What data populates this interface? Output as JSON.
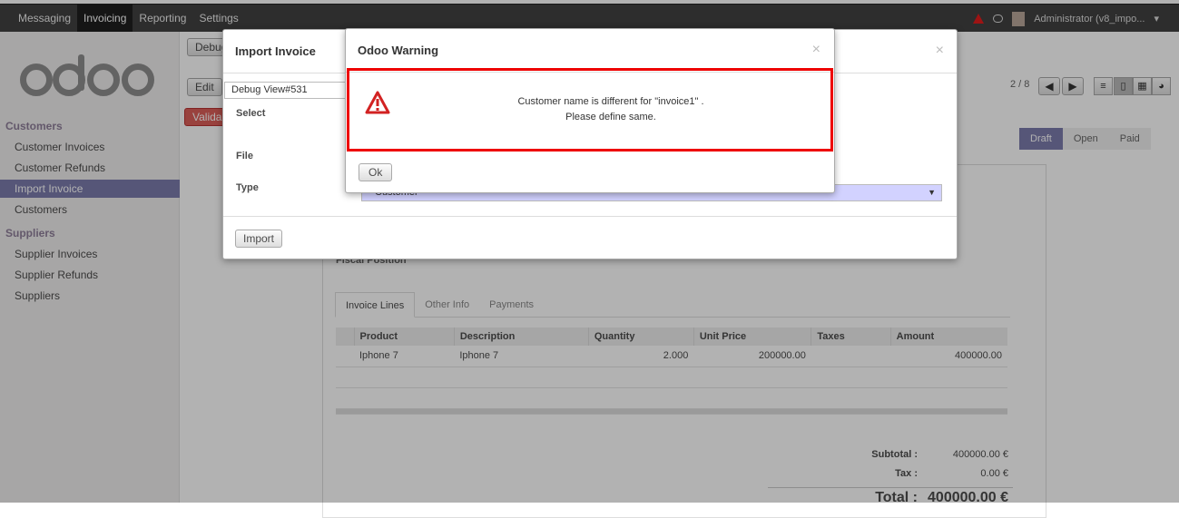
{
  "topbar": {
    "menu": [
      "Messaging",
      "Invoicing",
      "Reporting",
      "Settings"
    ],
    "active_menu": "Invoicing",
    "user": "Administrator (v8_impo..."
  },
  "sidebar": {
    "logo": "odoo",
    "sections": [
      {
        "label": "Customers",
        "items": [
          "Customer Invoices",
          "Customer Refunds",
          "Import Invoice",
          "Customers"
        ]
      },
      {
        "label": "Suppliers",
        "items": [
          "Supplier Invoices",
          "Supplier Refunds",
          "Suppliers"
        ]
      }
    ],
    "active_item": "Import Invoice"
  },
  "main": {
    "debug_label": "Debug",
    "edit_label": "Edit",
    "validate_label": "Valida",
    "pager": "2 / 8",
    "statusbar": [
      "Draft",
      "Open",
      "Paid"
    ],
    "active_status": "Draft",
    "fiscal_position_label": "Fiscal Position",
    "tabs": [
      "Invoice Lines",
      "Other Info",
      "Payments"
    ],
    "active_tab": "Invoice Lines",
    "lines_headers": [
      "Product",
      "Description",
      "Quantity",
      "Unit Price",
      "Taxes",
      "Amount"
    ],
    "lines": [
      {
        "product": "Iphone 7",
        "description": "Iphone 7",
        "quantity": "2.000",
        "unit_price": "200000.00",
        "taxes": "",
        "amount": "400000.00"
      }
    ],
    "subtotal_label": "Subtotal :",
    "subtotal": "400000.00 €",
    "tax_label": "Tax :",
    "tax": "0.00 €",
    "total_label": "Total :",
    "total": "400000.00 €"
  },
  "import_dialog": {
    "title": "Import Invoice",
    "debug_view": "Debug View#531",
    "select_label": "Select",
    "file_label": "File",
    "type_label": "Type",
    "type_value": "Customer",
    "import_button": "Import"
  },
  "warning_dialog": {
    "title": "Odoo Warning",
    "message_line1": "Customer name is different for \"invoice1\" .",
    "message_line2": "Please define same.",
    "ok_button": "Ok"
  },
  "colors": {
    "accent": "#7c7bad",
    "highlight_border": "#e00000",
    "warning_icon": "#d22222"
  }
}
